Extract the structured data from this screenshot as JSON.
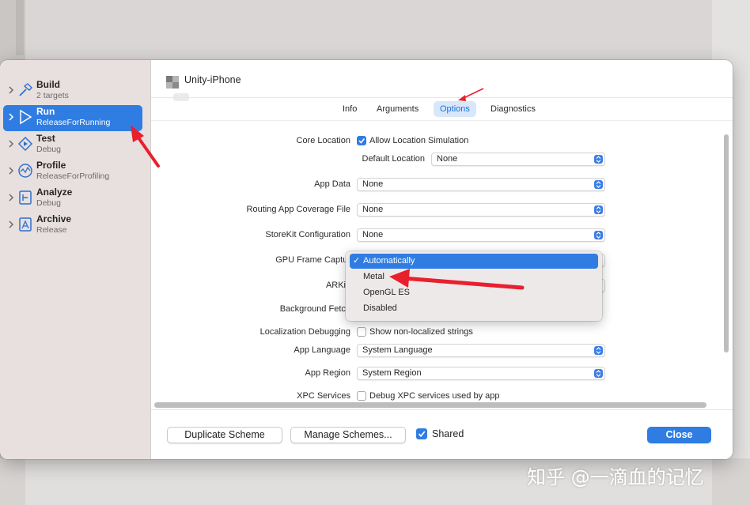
{
  "window": {
    "title": "Unity-iPhone"
  },
  "sidebar": {
    "items": [
      {
        "title": "Build",
        "subtitle": "2 targets",
        "icon": "hammer-icon"
      },
      {
        "title": "Run",
        "subtitle": "ReleaseForRunning",
        "icon": "play-icon",
        "selected": true
      },
      {
        "title": "Test",
        "subtitle": "Debug",
        "icon": "test-diamond-icon"
      },
      {
        "title": "Profile",
        "subtitle": "ReleaseForProfiling",
        "icon": "gauge-icon"
      },
      {
        "title": "Analyze",
        "subtitle": "Debug",
        "icon": "analyze-icon"
      },
      {
        "title": "Archive",
        "subtitle": "Release",
        "icon": "archive-icon"
      }
    ]
  },
  "tabs": [
    {
      "label": "Info"
    },
    {
      "label": "Arguments"
    },
    {
      "label": "Options",
      "selected": true
    },
    {
      "label": "Diagnostics"
    }
  ],
  "options": {
    "core_location": {
      "label": "Core Location",
      "checkbox_label": "Allow Location Simulation",
      "checked": true
    },
    "default_location": {
      "label": "Default Location",
      "value": "None"
    },
    "app_data": {
      "label": "App Data",
      "value": "None"
    },
    "routing": {
      "label": "Routing App Coverage File",
      "value": "None"
    },
    "storekit": {
      "label": "StoreKit Configuration",
      "value": "None"
    },
    "gpu_frame_capture": {
      "label": "GPU Frame Captur"
    },
    "arkit": {
      "label": "ARKi"
    },
    "background_fetch": {
      "label": "Background Fetch"
    },
    "localization_debugging": {
      "label": "Localization Debugging",
      "checkbox_label": "Show non-localized strings",
      "checked": false
    },
    "app_language": {
      "label": "App Language",
      "value": "System Language"
    },
    "app_region": {
      "label": "App Region",
      "value": "System Region"
    },
    "xpc_services": {
      "label": "XPC Services",
      "checkbox_label": "Debug XPC services used by app",
      "checked": false
    }
  },
  "gpu_menu": {
    "items": [
      {
        "label": "Automatically",
        "selected": true
      },
      {
        "label": "Metal"
      },
      {
        "label": "OpenGL ES"
      },
      {
        "label": "Disabled"
      }
    ]
  },
  "footer": {
    "duplicate_label": "Duplicate Scheme",
    "manage_label": "Manage Schemes...",
    "shared_label": "Shared",
    "shared_checked": true,
    "close_label": "Close"
  },
  "watermark": "知乎 @一滴血的记忆",
  "colors": {
    "accent": "#2f7de2",
    "annotation_arrow": "#e8202e",
    "sidebar_bg": "#e7e0de"
  }
}
